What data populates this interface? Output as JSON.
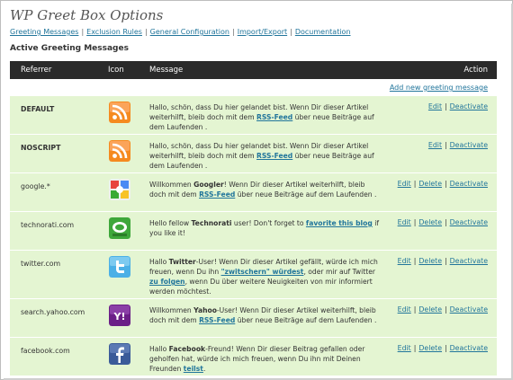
{
  "page": {
    "title": "WP Greet Box Options",
    "nav": [
      "Greeting Messages",
      "Exclusion Rules",
      "General Configuration",
      "Import/Export",
      "Documentation"
    ],
    "section_title": "Active Greeting Messages",
    "add_link": "Add new greeting message"
  },
  "table": {
    "headers": {
      "referrer": "Referrer",
      "icon": "Icon",
      "message": "Message",
      "action": "Action"
    }
  },
  "rows": [
    {
      "referrer": "DEFAULT",
      "bold": true,
      "icon": "rss-icon",
      "msg_parts": [
        "Hallo, schön, dass Du hier gelandet bist. Wenn Dir dieser Artikel weiterhilft, bleib doch mit dem ",
        "RSS-Feed",
        " über neue Beiträge auf dem Laufenden ."
      ],
      "actions": [
        "Edit",
        "Deactivate"
      ]
    },
    {
      "referrer": "NOSCRIPT",
      "bold": true,
      "icon": "rss-icon",
      "msg_parts": [
        "Hallo, schön, dass Du hier gelandet bist. Wenn Dir dieser Artikel weiterhilft, bleib doch mit dem ",
        "RSS-Feed",
        " über neue Beiträge auf dem Laufenden ."
      ],
      "actions": [
        "Edit",
        "Deactivate"
      ]
    },
    {
      "referrer": "google.*",
      "bold": false,
      "icon": "google-icon",
      "msg_parts": [
        "Willkommen ",
        "Googler",
        "! Wenn Dir dieser Artikel weiterhilft, bleib doch mit dem ",
        "RSS-Feed",
        " über neue Beiträge auf dem Laufenden ."
      ],
      "actions": [
        "Edit",
        "Delete",
        "Deactivate"
      ]
    },
    {
      "referrer": "technorati.com",
      "bold": false,
      "icon": "technorati-icon",
      "msg_parts": [
        "Hello fellow ",
        "Technorati",
        " user! Don't forget to ",
        "favorite this blog",
        " if you like it!"
      ],
      "actions": [
        "Edit",
        "Delete",
        "Deactivate"
      ]
    },
    {
      "referrer": "twitter.com",
      "bold": false,
      "icon": "twitter-icon",
      "msg_parts": [
        "Hallo ",
        "Twitter",
        "-User! Wenn Dir dieser Artikel gefällt, würde ich mich freuen, wenn Du ihn ",
        "\"zwitschern\" würdest",
        ", oder mir auf Twitter ",
        "zu folgen",
        ", wenn Du über weitere Neuigkeiten von mir informiert werden möchtest."
      ],
      "actions": [
        "Edit",
        "Delete",
        "Deactivate"
      ]
    },
    {
      "referrer": "search.yahoo.com",
      "bold": false,
      "icon": "yahoo-icon",
      "msg_parts": [
        "Willkommen ",
        "Yahoo",
        "-User! Wenn Dir dieser Artikel weiterhilft, bleib doch mit dem ",
        "RSS-Feed",
        " über neue Beiträge auf dem Laufenden ."
      ],
      "actions": [
        "Edit",
        "Delete",
        "Deactivate"
      ]
    },
    {
      "referrer": "facebook.com",
      "bold": false,
      "icon": "facebook-icon",
      "msg_parts": [
        "Hallo ",
        "Facebook",
        "-Freund! Wenn Dir dieser Beitrag gefallen oder geholfen hat, würde ich mich freuen, wenn Du ihn mit Deinen Freunden ",
        "teilst",
        "."
      ],
      "actions": [
        "Edit",
        "Delete",
        "Deactivate"
      ]
    }
  ],
  "colors": {
    "link": "#21759b",
    "header_bg": "#2a2a2a",
    "row_bg": "#e4f5d2"
  }
}
